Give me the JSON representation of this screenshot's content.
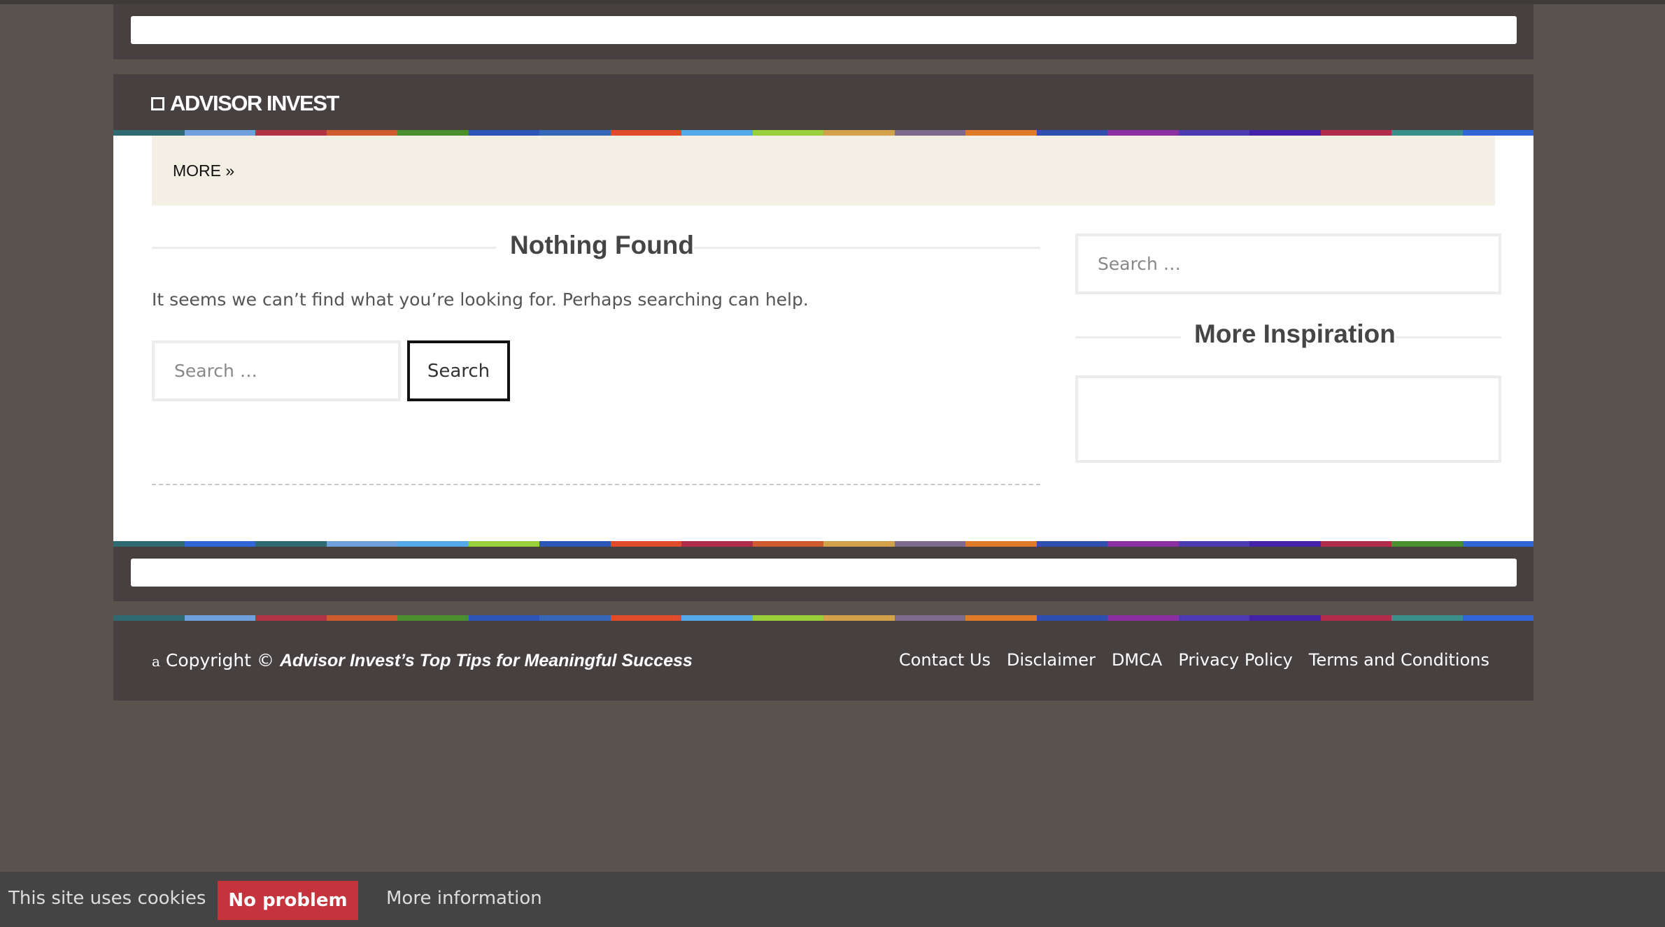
{
  "site": {
    "logo_text": "ADVISOR INVEST"
  },
  "nav": {
    "more_label": "MORE »"
  },
  "content": {
    "title": "Nothing Found",
    "message": "It seems we can’t find what you’re looking for. Perhaps searching can help.",
    "search_placeholder": "Search …",
    "search_button": "Search"
  },
  "sidebar": {
    "search_placeholder": "Search …",
    "widget_title": "More Inspiration"
  },
  "footer": {
    "copyright_prefix": "a",
    "copyright_text": "Copyright ©",
    "copyright_site": "Advisor Invest’s Top Tips for Meaningful Success",
    "links": [
      "Contact Us",
      "Disclaimer",
      "DMCA",
      "Privacy Policy",
      "Terms and Conditions"
    ]
  },
  "cookie": {
    "text": "This site uses cookies",
    "accept_label": "No problem",
    "more_label": "More information"
  },
  "colors": {
    "page_bg": "#59534d",
    "panel_bg": "#464140",
    "more_bar_bg": "#f4efe4",
    "cookie_button": "#c5343c",
    "stripe_colors": [
      "#2f6a73",
      "#6fa0dc",
      "#b23344",
      "#cf5a2e",
      "#4a8f2f",
      "#2d55b8",
      "#3567b8",
      "#e04c2a",
      "#55a9e8",
      "#9bcf3a",
      "#d2a24a",
      "#7e6a8c",
      "#e07a2a",
      "#2f4fb0",
      "#8b2fa3",
      "#4d3ab3",
      "#4422a8",
      "#b12c4a",
      "#3a8f8a",
      "#3266d8"
    ],
    "stripe_colors_bottom": [
      "#2f6a73",
      "#3266d8",
      "#2f6a73",
      "#6fa0dc",
      "#55a9e8",
      "#9bcf3a",
      "#2d55b8",
      "#e04c2a",
      "#b12c4a",
      "#cf5a2e",
      "#d2a24a",
      "#7e6a8c",
      "#e07a2a",
      "#2f4fb0",
      "#8b2fa3",
      "#4d3ab3",
      "#4422a8",
      "#b12c4a",
      "#4a8f2f",
      "#3266d8"
    ]
  }
}
